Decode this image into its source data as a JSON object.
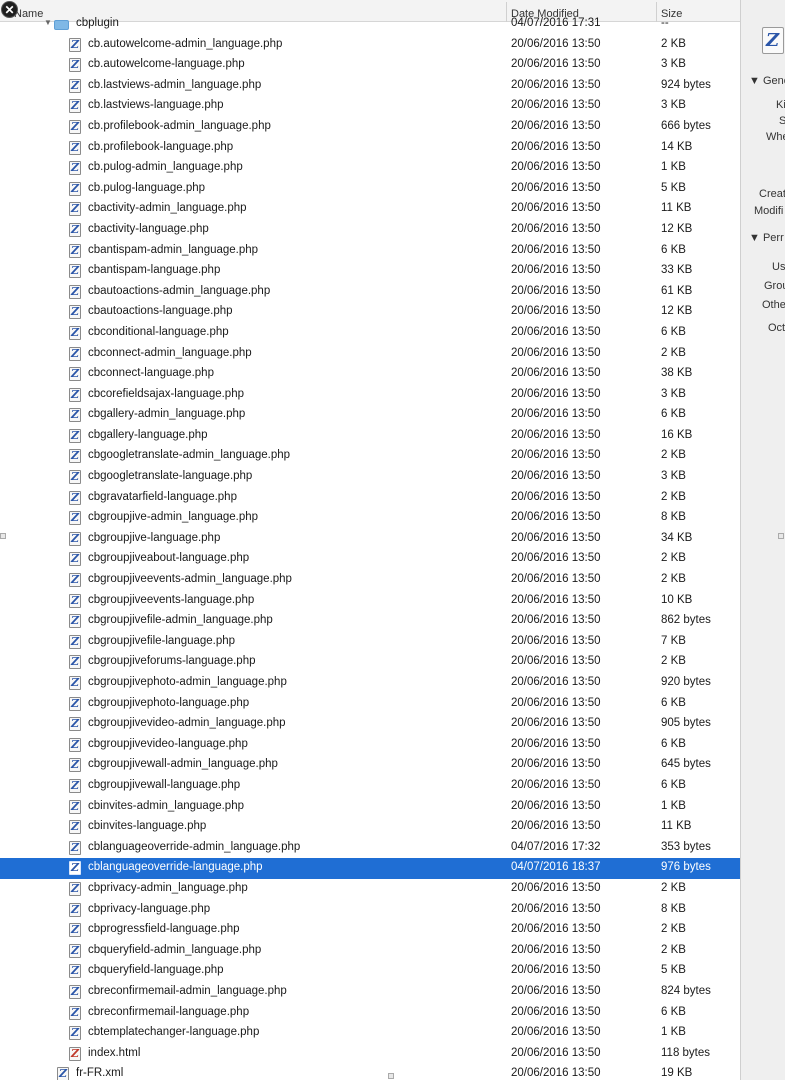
{
  "columns": {
    "name": "Name",
    "date": "Date Modified",
    "size": "Size"
  },
  "rows": [
    {
      "name": "cbplugin",
      "date": "04/07/2016 17:31",
      "size": "--",
      "kind": "folder"
    },
    {
      "name": "cb.autowelcome-admin_language.php",
      "date": "20/06/2016 13:50",
      "size": "2 KB"
    },
    {
      "name": "cb.autowelcome-language.php",
      "date": "20/06/2016 13:50",
      "size": "3 KB"
    },
    {
      "name": "cb.lastviews-admin_language.php",
      "date": "20/06/2016 13:50",
      "size": "924 bytes"
    },
    {
      "name": "cb.lastviews-language.php",
      "date": "20/06/2016 13:50",
      "size": "3 KB"
    },
    {
      "name": "cb.profilebook-admin_language.php",
      "date": "20/06/2016 13:50",
      "size": "666 bytes"
    },
    {
      "name": "cb.profilebook-language.php",
      "date": "20/06/2016 13:50",
      "size": "14 KB"
    },
    {
      "name": "cb.pulog-admin_language.php",
      "date": "20/06/2016 13:50",
      "size": "1 KB"
    },
    {
      "name": "cb.pulog-language.php",
      "date": "20/06/2016 13:50",
      "size": "5 KB"
    },
    {
      "name": "cbactivity-admin_language.php",
      "date": "20/06/2016 13:50",
      "size": "11 KB"
    },
    {
      "name": "cbactivity-language.php",
      "date": "20/06/2016 13:50",
      "size": "12 KB"
    },
    {
      "name": "cbantispam-admin_language.php",
      "date": "20/06/2016 13:50",
      "size": "6 KB"
    },
    {
      "name": "cbantispam-language.php",
      "date": "20/06/2016 13:50",
      "size": "33 KB"
    },
    {
      "name": "cbautoactions-admin_language.php",
      "date": "20/06/2016 13:50",
      "size": "61 KB"
    },
    {
      "name": "cbautoactions-language.php",
      "date": "20/06/2016 13:50",
      "size": "12 KB"
    },
    {
      "name": "cbconditional-language.php",
      "date": "20/06/2016 13:50",
      "size": "6 KB"
    },
    {
      "name": "cbconnect-admin_language.php",
      "date": "20/06/2016 13:50",
      "size": "2 KB"
    },
    {
      "name": "cbconnect-language.php",
      "date": "20/06/2016 13:50",
      "size": "38 KB"
    },
    {
      "name": "cbcorefieldsajax-language.php",
      "date": "20/06/2016 13:50",
      "size": "3 KB"
    },
    {
      "name": "cbgallery-admin_language.php",
      "date": "20/06/2016 13:50",
      "size": "6 KB"
    },
    {
      "name": "cbgallery-language.php",
      "date": "20/06/2016 13:50",
      "size": "16 KB"
    },
    {
      "name": "cbgoogletranslate-admin_language.php",
      "date": "20/06/2016 13:50",
      "size": "2 KB"
    },
    {
      "name": "cbgoogletranslate-language.php",
      "date": "20/06/2016 13:50",
      "size": "3 KB"
    },
    {
      "name": "cbgravatarfield-language.php",
      "date": "20/06/2016 13:50",
      "size": "2 KB"
    },
    {
      "name": "cbgroupjive-admin_language.php",
      "date": "20/06/2016 13:50",
      "size": "8 KB"
    },
    {
      "name": "cbgroupjive-language.php",
      "date": "20/06/2016 13:50",
      "size": "34 KB"
    },
    {
      "name": "cbgroupjiveabout-language.php",
      "date": "20/06/2016 13:50",
      "size": "2 KB"
    },
    {
      "name": "cbgroupjiveevents-admin_language.php",
      "date": "20/06/2016 13:50",
      "size": "2 KB"
    },
    {
      "name": "cbgroupjiveevents-language.php",
      "date": "20/06/2016 13:50",
      "size": "10 KB"
    },
    {
      "name": "cbgroupjivefile-admin_language.php",
      "date": "20/06/2016 13:50",
      "size": "862 bytes"
    },
    {
      "name": "cbgroupjivefile-language.php",
      "date": "20/06/2016 13:50",
      "size": "7 KB"
    },
    {
      "name": "cbgroupjiveforums-language.php",
      "date": "20/06/2016 13:50",
      "size": "2 KB"
    },
    {
      "name": "cbgroupjivephoto-admin_language.php",
      "date": "20/06/2016 13:50",
      "size": "920 bytes"
    },
    {
      "name": "cbgroupjivephoto-language.php",
      "date": "20/06/2016 13:50",
      "size": "6 KB"
    },
    {
      "name": "cbgroupjivevideo-admin_language.php",
      "date": "20/06/2016 13:50",
      "size": "905 bytes"
    },
    {
      "name": "cbgroupjivevideo-language.php",
      "date": "20/06/2016 13:50",
      "size": "6 KB"
    },
    {
      "name": "cbgroupjivewall-admin_language.php",
      "date": "20/06/2016 13:50",
      "size": "645 bytes"
    },
    {
      "name": "cbgroupjivewall-language.php",
      "date": "20/06/2016 13:50",
      "size": "6 KB"
    },
    {
      "name": "cbinvites-admin_language.php",
      "date": "20/06/2016 13:50",
      "size": "1 KB"
    },
    {
      "name": "cbinvites-language.php",
      "date": "20/06/2016 13:50",
      "size": "11 KB"
    },
    {
      "name": "cblanguageoverride-admin_language.php",
      "date": "04/07/2016 17:32",
      "size": "353 bytes"
    },
    {
      "name": "cblanguageoverride-language.php",
      "date": "04/07/2016 18:37",
      "size": "976 bytes",
      "selected": true
    },
    {
      "name": "cbprivacy-admin_language.php",
      "date": "20/06/2016 13:50",
      "size": "2 KB"
    },
    {
      "name": "cbprivacy-language.php",
      "date": "20/06/2016 13:50",
      "size": "8 KB"
    },
    {
      "name": "cbprogressfield-language.php",
      "date": "20/06/2016 13:50",
      "size": "2 KB"
    },
    {
      "name": "cbqueryfield-admin_language.php",
      "date": "20/06/2016 13:50",
      "size": "2 KB"
    },
    {
      "name": "cbqueryfield-language.php",
      "date": "20/06/2016 13:50",
      "size": "5 KB"
    },
    {
      "name": "cbreconfirmemail-admin_language.php",
      "date": "20/06/2016 13:50",
      "size": "824 bytes"
    },
    {
      "name": "cbreconfirmemail-language.php",
      "date": "20/06/2016 13:50",
      "size": "6 KB"
    },
    {
      "name": "cbtemplatechanger-language.php",
      "date": "20/06/2016 13:50",
      "size": "1 KB"
    },
    {
      "name": "index.html",
      "date": "20/06/2016 13:50",
      "size": "118 bytes",
      "kind": "html"
    },
    {
      "name": "fr-FR.xml",
      "date": "20/06/2016 13:50",
      "size": "19 KB",
      "level": 0
    }
  ],
  "info": {
    "sections": [
      "Gene",
      "Perr"
    ],
    "labels": [
      "Ki",
      "S",
      "Whe",
      "Creat",
      "Modifi",
      "Us",
      "Grou",
      "Othe",
      "Oct"
    ]
  },
  "colors": {
    "selection": "#1f6ed4",
    "folder": "#7fb8e6",
    "file_glyph": "#2a55a8"
  },
  "icons": {
    "close": "close-icon",
    "php_file": "php-file-icon",
    "folder": "folder-icon"
  }
}
